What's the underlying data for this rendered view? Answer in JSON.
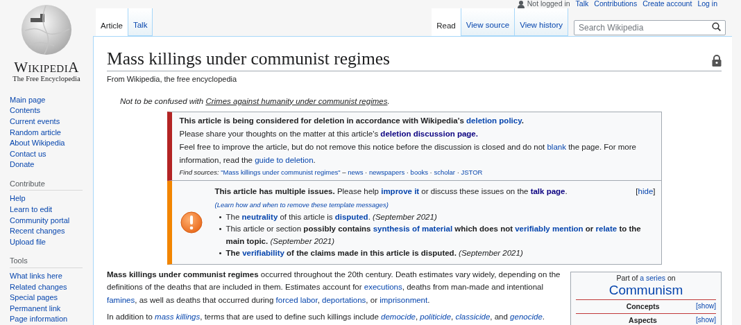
{
  "personal_tools": {
    "status": "Not logged in",
    "links": [
      "Talk",
      "Contributions",
      "Create account",
      "Log in"
    ]
  },
  "logo": {
    "wordmark": "WikipediA",
    "tagline": "The Free Encyclopedia"
  },
  "namespace_tabs": [
    {
      "label": "Article",
      "selected": true
    },
    {
      "label": "Talk",
      "selected": false
    }
  ],
  "view_tabs": [
    {
      "label": "Read",
      "selected": true
    },
    {
      "label": "View source",
      "selected": false
    },
    {
      "label": "View history",
      "selected": false
    }
  ],
  "search": {
    "placeholder": "Search Wikipedia"
  },
  "sidebar": {
    "navigation": [
      "Main page",
      "Contents",
      "Current events",
      "Random article",
      "About Wikipedia",
      "Contact us",
      "Donate"
    ],
    "sections": [
      {
        "heading": "Contribute",
        "items": [
          "Help",
          "Learn to edit",
          "Community portal",
          "Recent changes",
          "Upload file"
        ]
      },
      {
        "heading": "Tools",
        "items": [
          "What links here",
          "Related changes",
          "Special pages",
          "Permanent link",
          "Page information"
        ]
      }
    ]
  },
  "article": {
    "title": "Mass killings under communist regimes",
    "tagline": "From Wikipedia, the free encyclopedia",
    "protected": true,
    "hatnote": [
      "Not to be confused with ",
      {
        "link": "Crimes against humanity under communist regimes"
      },
      "."
    ],
    "deletion_notice": {
      "lines": [
        [
          "**This article is being considered for deletion in accordance with Wikipedia's** ",
          {
            "link": "deletion policy",
            "bold": true
          },
          "**.**"
        ],
        [
          "Please share your thoughts on the matter at this article's ",
          {
            "link": "deletion discussion page.",
            "bold": true,
            "visited": true
          }
        ],
        [
          "Feel free to improve the article, but do not remove this notice before the discussion is closed and do not ",
          {
            "link": "blank"
          },
          " the page. For more information, read the ",
          {
            "link": "guide to deletion"
          },
          "."
        ]
      ],
      "find_sources": [
        "*Find sources:* ",
        {
          "link": "\"Mass killings under communist regimes\""
        },
        " – ",
        {
          "link": "news"
        },
        " · ",
        {
          "link": "newspapers"
        },
        " · ",
        {
          "link": "books"
        },
        " · ",
        {
          "link": "scholar"
        },
        " · ",
        {
          "link": "JSTOR"
        }
      ]
    },
    "issues": {
      "toggle": [
        "[",
        {
          "link": "hide"
        },
        "]"
      ],
      "header": [
        "**This article has multiple issues.** Please help ",
        {
          "link": "improve it",
          "bold": true
        },
        " or discuss these issues on the ",
        {
          "link": "talk page",
          "bold": true,
          "visited": true
        },
        ". ",
        {
          "link": "(Learn how and when to remove these template messages)",
          "italic": true,
          "small": true
        }
      ],
      "bullet": "•",
      "items": [
        [
          "The ",
          {
            "link": "neutrality",
            "bold": true
          },
          " of this article is ",
          {
            "link": "disputed",
            "bold": true
          },
          ". *(September 2021)*"
        ],
        [
          "This article or section **possibly contains** ",
          {
            "link": "synthesis of material",
            "bold": true
          },
          " **which does not** ",
          {
            "link": "verifiably mention",
            "bold": true
          },
          " **or** ",
          {
            "link": "relate",
            "bold": true
          },
          " **to the main topic.** *(September 2021)*"
        ],
        [
          "**The** ",
          {
            "link": "verifiability",
            "bold": true
          },
          " **of the claims made in this article is disputed.** *(September 2021)*"
        ]
      ]
    },
    "infobox": {
      "intro": [
        "Part of ",
        {
          "link": "a series"
        },
        " on"
      ],
      "title": "Communism",
      "sections": [
        {
          "label": "Concepts",
          "toggle": "[show]"
        },
        {
          "label": "Aspects",
          "toggle": "[show]"
        }
      ]
    },
    "paragraphs": [
      [
        "**Mass killings under communist regimes** occurred throughout the 20th century. Death estimates vary widely, depending on the definitions of the deaths that are included in them. Estimates account for ",
        {
          "link": "executions"
        },
        ", deaths from man-made and intentional ",
        {
          "link": "famines"
        },
        ", as well as deaths that occurred during ",
        {
          "link": "forced labor"
        },
        ", ",
        {
          "link": "deportations"
        },
        ", or ",
        {
          "link": "imprisonment"
        },
        "."
      ],
      [
        "In addition to ",
        {
          "link": "mass killings",
          "italic": true
        },
        ", terms that are used to define such killings include ",
        {
          "link": "democide",
          "italic": true
        },
        ", ",
        {
          "link": "politicide",
          "italic": true
        },
        ", ",
        {
          "link": "classicide",
          "italic": true
        },
        ", and ",
        {
          "link": "genocide",
          "italic": true
        },
        "."
      ]
    ]
  }
}
